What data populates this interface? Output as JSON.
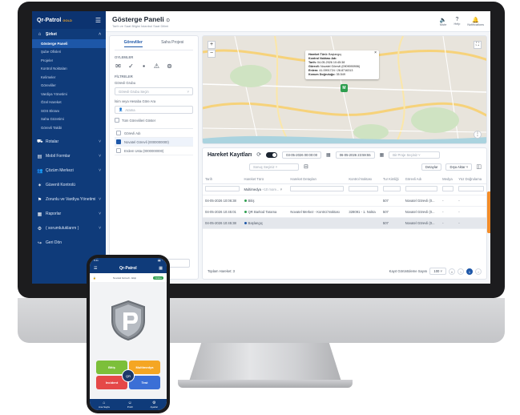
{
  "sidebar": {
    "logo": "Qr-Patrol",
    "logo_badge": "GOLD",
    "groups": [
      {
        "label": "Şirket",
        "icon": "home-icon"
      },
      {
        "label": "Rotalar",
        "icon": "route-icon"
      },
      {
        "label": "Mobil Formlar",
        "icon": "form-icon"
      },
      {
        "label": "Çözüm Merkezi",
        "icon": "users-icon"
      },
      {
        "label": "Güvenli Kontrolü",
        "icon": "shield-icon"
      },
      {
        "label": "Zorunlu ve Vardiya Yönetimi",
        "icon": "shift-icon"
      },
      {
        "label": "Raporlar",
        "icon": "chart-icon"
      },
      {
        "label": "( sorumluluklarım )",
        "icon": "gear-icon"
      },
      {
        "label": "Geri Dön",
        "icon": "back-icon"
      }
    ],
    "company_items": [
      "Gösterge Paneli",
      "Şube Ofisleri",
      "Projeler",
      "Kontrol Noktaları",
      "Kelimeler",
      "Görevliler",
      "Vardiya Yönetimi",
      "Özel Hareket",
      "SOS Ekranı",
      "Saha Gözetimi",
      "Görevli Takibi"
    ]
  },
  "topbar": {
    "title": "Gösterge Paneli",
    "subtitle": "Tarih ve Saat Bilgisi İstanbul Saat Dilimi",
    "actions": [
      {
        "label": "Mute",
        "icon": "speaker-icon"
      },
      {
        "label": "Help",
        "icon": "help-icon"
      },
      {
        "label": "Notifications",
        "icon": "bell-icon"
      }
    ]
  },
  "filters": {
    "tabs": [
      "Görevliler",
      "Saha Projesi"
    ],
    "events_label": "OYLEMLER",
    "filters_label": "FİLTRELER",
    "group_label": "Görevli Grubu",
    "group_placeholder": "Görevli Grubu Seçin",
    "search_label": "İsim veya Hesaba Göre Ara",
    "search_placeholder": "Arama",
    "show_all": "Tüm Görevlileri Göster",
    "list": [
      {
        "name": "Görevli Adı",
        "checked": false
      },
      {
        "name": "Novatel Görevli (0000000000)",
        "checked": true
      },
      {
        "name": "Erdem Usta (0000000000)",
        "checked": false
      }
    ],
    "clear_button": "Filtreleri Temizle"
  },
  "map": {
    "popup": [
      {
        "k": "Hareket Türü:",
        "v": "Başlangıç"
      },
      {
        "k": "Kontrol Noktası Adı:",
        "v": ""
      },
      {
        "k": "Tarih:",
        "v": "04-05-2026 10:45:38"
      },
      {
        "k": "Görevli:",
        "v": "Novatel Görevli (0909090906)"
      },
      {
        "k": "Enlem:",
        "v": "41.0991724 / 28.8716313"
      },
      {
        "k": "Konum Doğruluğu:",
        "v": "35.549"
      }
    ]
  },
  "records": {
    "title": "Hareket Kayıtları",
    "date_from": "03-05-2026 00:00:00",
    "date_to": "06-05-2026 23:59:55",
    "project_placeholder": "Bir Proje Seçiniz",
    "status_placeholder": "Sonuç Seçiniz",
    "details_button": "Detaylar",
    "export_button": "Dışa Aktar",
    "columns": [
      "Tarih",
      "Hareket Türü",
      "Hareket Detayları",
      "Kontrol Noktası",
      "Tur Kimliği",
      "Görevli Adı",
      "Medya",
      "Yüz Doğrulama"
    ],
    "filter_hint": "Multimedya",
    "filter_hint2": "+10 more...",
    "rows": [
      {
        "date": "04-05-2026 10:06:38",
        "type": "Bitiş",
        "color": "#2e9e4f",
        "details": "",
        "point": "",
        "tour": "507",
        "guard": "Novatel Görevli (0...",
        "media": "-",
        "face": "-",
        "selected": false
      },
      {
        "date": "04-05-2026 10:45:01",
        "type": "QR Barkod Tarama",
        "color": "#2e9e4f",
        "details": "Novatel Merkez - Kontrol Noktası",
        "point": "328091 - 1. Nokta",
        "tour": "507",
        "guard": "Novatel Görevli (0...",
        "media": "-",
        "face": "-",
        "selected": false
      },
      {
        "date": "04-05-2026 10:45:38",
        "type": "Başlangıç",
        "color": "#1d57a8",
        "details": "",
        "point": "",
        "tour": "507",
        "guard": "Novatel Görevli (0...",
        "media": "-",
        "face": "-",
        "selected": true
      }
    ],
    "total": "Toplam Hareket: 3",
    "per_page_label": "Kayıt Görüntüleme Sayısı",
    "per_page": "100",
    "page": "1"
  },
  "phone": {
    "status_time": "9:41",
    "title": "Qr-Patrol",
    "user_info": "Novatel Görevli - Ekip",
    "online_label": "Online",
    "tiles": [
      "Bitiş",
      "Multimedya",
      "Incident",
      "Test"
    ],
    "qr_label": "QR",
    "tabs": [
      {
        "label": "Ana Sayfa",
        "icon": "home-icon"
      },
      {
        "label": "Profil",
        "icon": "user-icon"
      },
      {
        "label": "Ayarlar",
        "icon": "gear-icon"
      }
    ]
  }
}
